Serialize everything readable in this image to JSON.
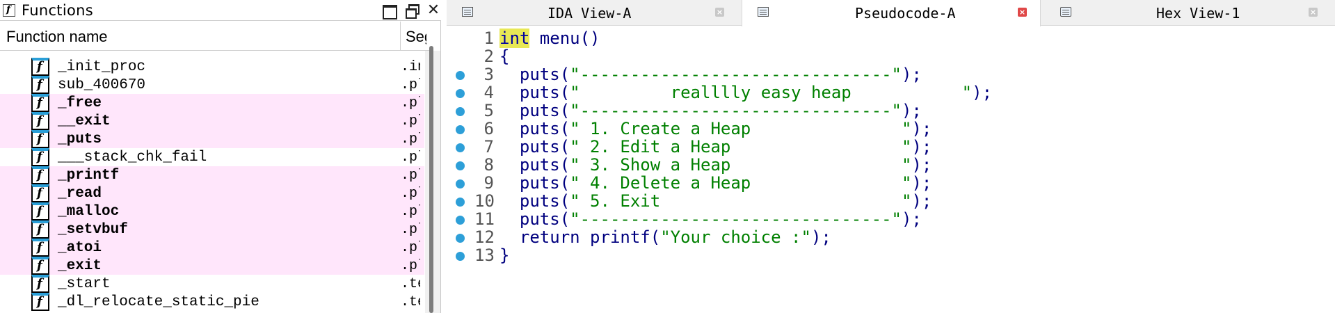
{
  "functions_panel": {
    "title": "Functions",
    "title_icon": "f",
    "column_name": "Function name",
    "column_segment": "Segment",
    "rows": [
      {
        "name": "_init_proc",
        "segment": ".init",
        "library": false
      },
      {
        "name": "sub_400670",
        "segment": ".plt",
        "library": false
      },
      {
        "name": "_free",
        "segment": ".plt",
        "library": true
      },
      {
        "name": "__exit",
        "segment": ".plt",
        "library": true
      },
      {
        "name": "_puts",
        "segment": ".plt",
        "library": true
      },
      {
        "name": "___stack_chk_fail",
        "segment": ".plt",
        "library": false
      },
      {
        "name": "_printf",
        "segment": ".plt",
        "library": true
      },
      {
        "name": "_read",
        "segment": ".plt",
        "library": true
      },
      {
        "name": "_malloc",
        "segment": ".plt",
        "library": true
      },
      {
        "name": "_setvbuf",
        "segment": ".plt",
        "library": true
      },
      {
        "name": "_atoi",
        "segment": ".plt",
        "library": true
      },
      {
        "name": "_exit",
        "segment": ".plt",
        "library": true
      },
      {
        "name": "_start",
        "segment": ".text",
        "library": false
      },
      {
        "name": "_dl_relocate_static_pie",
        "segment": ".text",
        "library": false
      }
    ],
    "row_icon": "f",
    "library_color": "#ffe6fb"
  },
  "tabs": [
    {
      "label": "IDA View-A",
      "icon": "text-view-icon",
      "active": false
    },
    {
      "label": "Pseudocode-A",
      "icon": "pseudocode-icon",
      "active": true
    },
    {
      "label": "Hex View-1",
      "icon": "hex-view-icon",
      "active": false
    }
  ],
  "tab_close_glyph": "×",
  "code": {
    "line1": {
      "num": "1",
      "kw": "int",
      "rest": " menu()"
    },
    "line2": {
      "num": "2",
      "text": "{"
    },
    "lines": [
      {
        "num": "3",
        "call": "  puts(",
        "str": "\"-------------------------------\"",
        "tail": ");"
      },
      {
        "num": "4",
        "call": "  puts(",
        "str": "\"         realllly easy heap           \"",
        "tail": ");"
      },
      {
        "num": "5",
        "call": "  puts(",
        "str": "\"-------------------------------\"",
        "tail": ");"
      },
      {
        "num": "6",
        "call": "  puts(",
        "str": "\" 1. Create a Heap               \"",
        "tail": ");"
      },
      {
        "num": "7",
        "call": "  puts(",
        "str": "\" 2. Edit a Heap                 \"",
        "tail": ");"
      },
      {
        "num": "8",
        "call": "  puts(",
        "str": "\" 3. Show a Heap                 \"",
        "tail": ");"
      },
      {
        "num": "9",
        "call": "  puts(",
        "str": "\" 4. Delete a Heap               \"",
        "tail": ");"
      },
      {
        "num": "10",
        "call": "  puts(",
        "str": "\" 5. Exit                        \"",
        "tail": ");"
      },
      {
        "num": "11",
        "call": "  puts(",
        "str": "\"-------------------------------\"",
        "tail": ");"
      },
      {
        "num": "12",
        "call": "  return printf(",
        "str": "\"Your choice :\"",
        "tail": ");"
      }
    ],
    "line13": {
      "num": "13",
      "text": "}"
    },
    "colors": {
      "keyword_highlight": "#e8e855",
      "string": "#008000",
      "code": "#00007f",
      "breakpoint_dot": "#2d9fd8"
    }
  }
}
